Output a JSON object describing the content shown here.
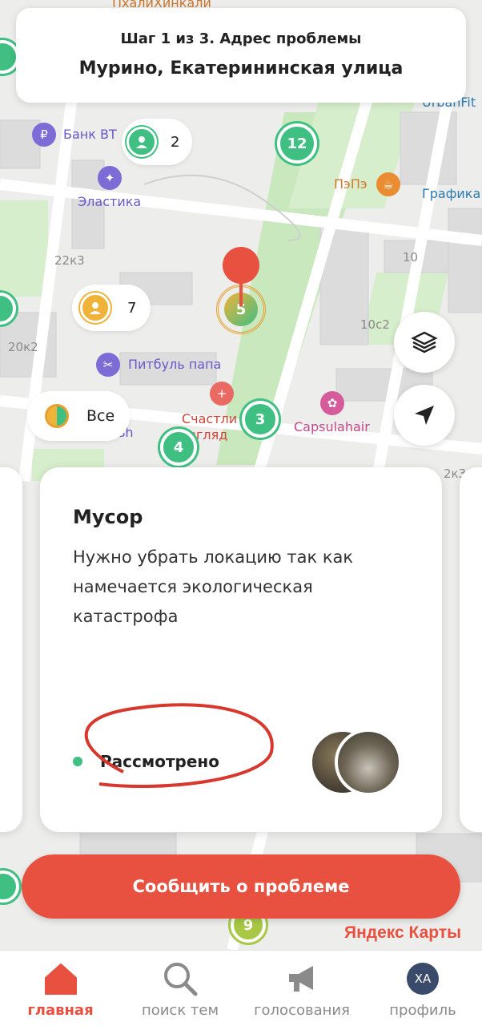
{
  "header": {
    "step": "Шаг 1 из 3. Адрес проблемы",
    "address": "Мурино, Екатерининская улица"
  },
  "map": {
    "labels": [
      {
        "id": "phali",
        "text": "ПхалиХинкали",
        "color": "#c8762c"
      },
      {
        "id": "bank",
        "text": "Банк ВТ",
        "color": "#6a58c8"
      },
      {
        "id": "elastika",
        "text": "Эластика",
        "color": "#6a58c8"
      },
      {
        "id": "pepe",
        "text": "ПэПэ",
        "color": "#d2792a"
      },
      {
        "id": "grafika",
        "text": "Графика",
        "color": "#2c7ab0"
      },
      {
        "id": "urban",
        "text": "UrbanFit",
        "color": "#2c7ab0"
      },
      {
        "id": "h22k3",
        "text": "22к3",
        "color": "#8a8a8a"
      },
      {
        "id": "h10",
        "text": "10",
        "color": "#8a8a8a"
      },
      {
        "id": "h10c2",
        "text": "10с2",
        "color": "#8a8a8a"
      },
      {
        "id": "h20k2",
        "text": "20к2",
        "color": "#8a8a8a"
      },
      {
        "id": "pitbul",
        "text": "Питбуль папа",
        "color": "#6a58c8"
      },
      {
        "id": "schastli",
        "text": "Счастли",
        "color": "#d0443a"
      },
      {
        "id": "vzglyad",
        "text": "взгляд",
        "color": "#d0443a"
      },
      {
        "id": "capsula",
        "text": "Capsulahair",
        "color": "#c0488a"
      },
      {
        "id": "h2k3",
        "text": "2к3",
        "color": "#8a8a8a"
      },
      {
        "id": "sh",
        "text": "sh",
        "color": "#6a58c8"
      }
    ],
    "pills": [
      {
        "id": "bank-users",
        "count": "2"
      },
      {
        "id": "yellow-users",
        "count": "7"
      }
    ],
    "clusters": [
      {
        "id": "c12",
        "count": "12"
      },
      {
        "id": "c3",
        "count": "3"
      },
      {
        "id": "c4",
        "count": "4"
      },
      {
        "id": "c9",
        "count": "9"
      },
      {
        "id": "c5",
        "count": "5"
      }
    ],
    "filter_all": "Все",
    "layers_icon": "layers-icon",
    "locate_icon": "navigation-arrow-icon",
    "attribution": "Яндекс Карты"
  },
  "card": {
    "title": "Мусор",
    "description": "Нужно убрать локацию так как намечается экологическая катастрофа",
    "status": "Рассмотрено",
    "status_color": "#3fbf82"
  },
  "report_button": "Сообщить о проблеме",
  "tabs": [
    {
      "id": "home",
      "label": "главная",
      "icon": "home-icon",
      "active": true
    },
    {
      "id": "search",
      "label": "поиск тем",
      "icon": "search-icon",
      "active": false
    },
    {
      "id": "voting",
      "label": "голосования",
      "icon": "megaphone-icon",
      "active": false
    },
    {
      "id": "profile",
      "label": "профиль",
      "icon": "avatar",
      "initials": "ХА",
      "active": false
    }
  ],
  "colors": {
    "accent": "#e8503f",
    "green": "#3fbf82",
    "map_bg": "#eeeeec"
  }
}
